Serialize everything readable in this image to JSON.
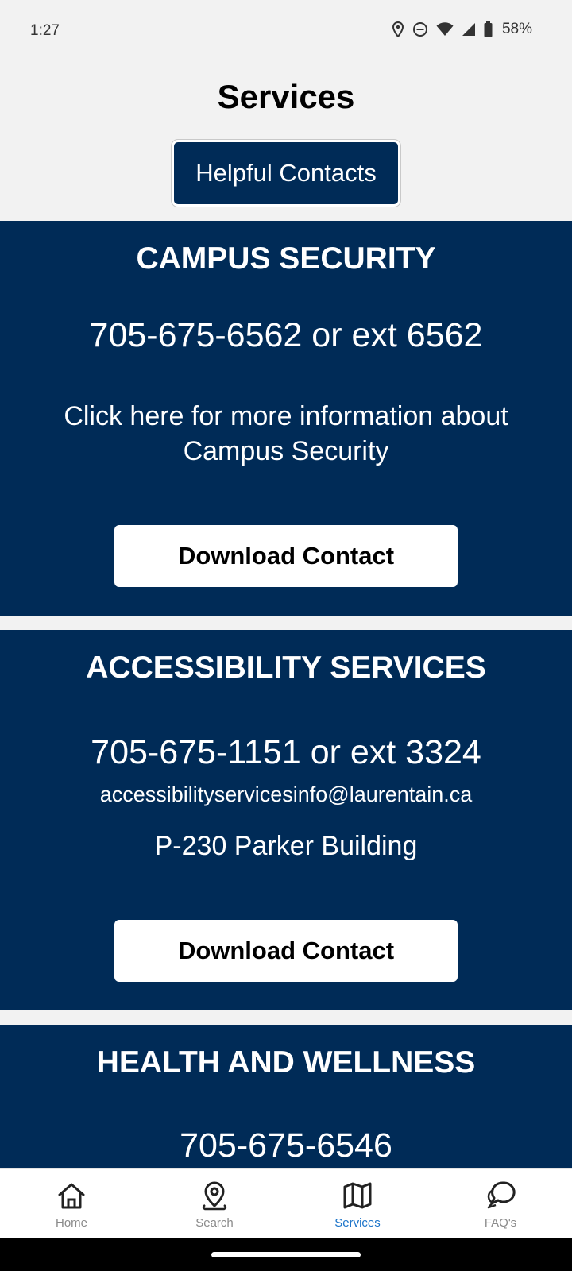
{
  "status_bar": {
    "time": "1:27",
    "battery": "58%"
  },
  "header": {
    "title": "Services",
    "contacts_button": "Helpful Contacts"
  },
  "cards": [
    {
      "title": "CAMPUS SECURITY",
      "phone": "705-675-6562 or ext 6562",
      "info": "Click here for more information about Campus Security",
      "button": "Download Contact"
    },
    {
      "title": "ACCESSIBILITY SERVICES",
      "phone": "705-675-1151 or ext 3324",
      "email": "accessibilityservicesinfo@laurentain.ca",
      "location": "P-230 Parker Building",
      "button": "Download Contact"
    },
    {
      "title": "HEALTH AND WELLNESS",
      "phone": "705-675-6546"
    }
  ],
  "nav": [
    {
      "label": "Home",
      "icon": "home-icon"
    },
    {
      "label": "Search",
      "icon": "map-pin-icon"
    },
    {
      "label": "Services",
      "icon": "map-icon",
      "active": true
    },
    {
      "label": "FAQ's",
      "icon": "chat-bubbles-icon"
    }
  ],
  "colors": {
    "primary": "#002b57",
    "active_nav": "#1a73c9",
    "background": "#f2f2f2"
  }
}
